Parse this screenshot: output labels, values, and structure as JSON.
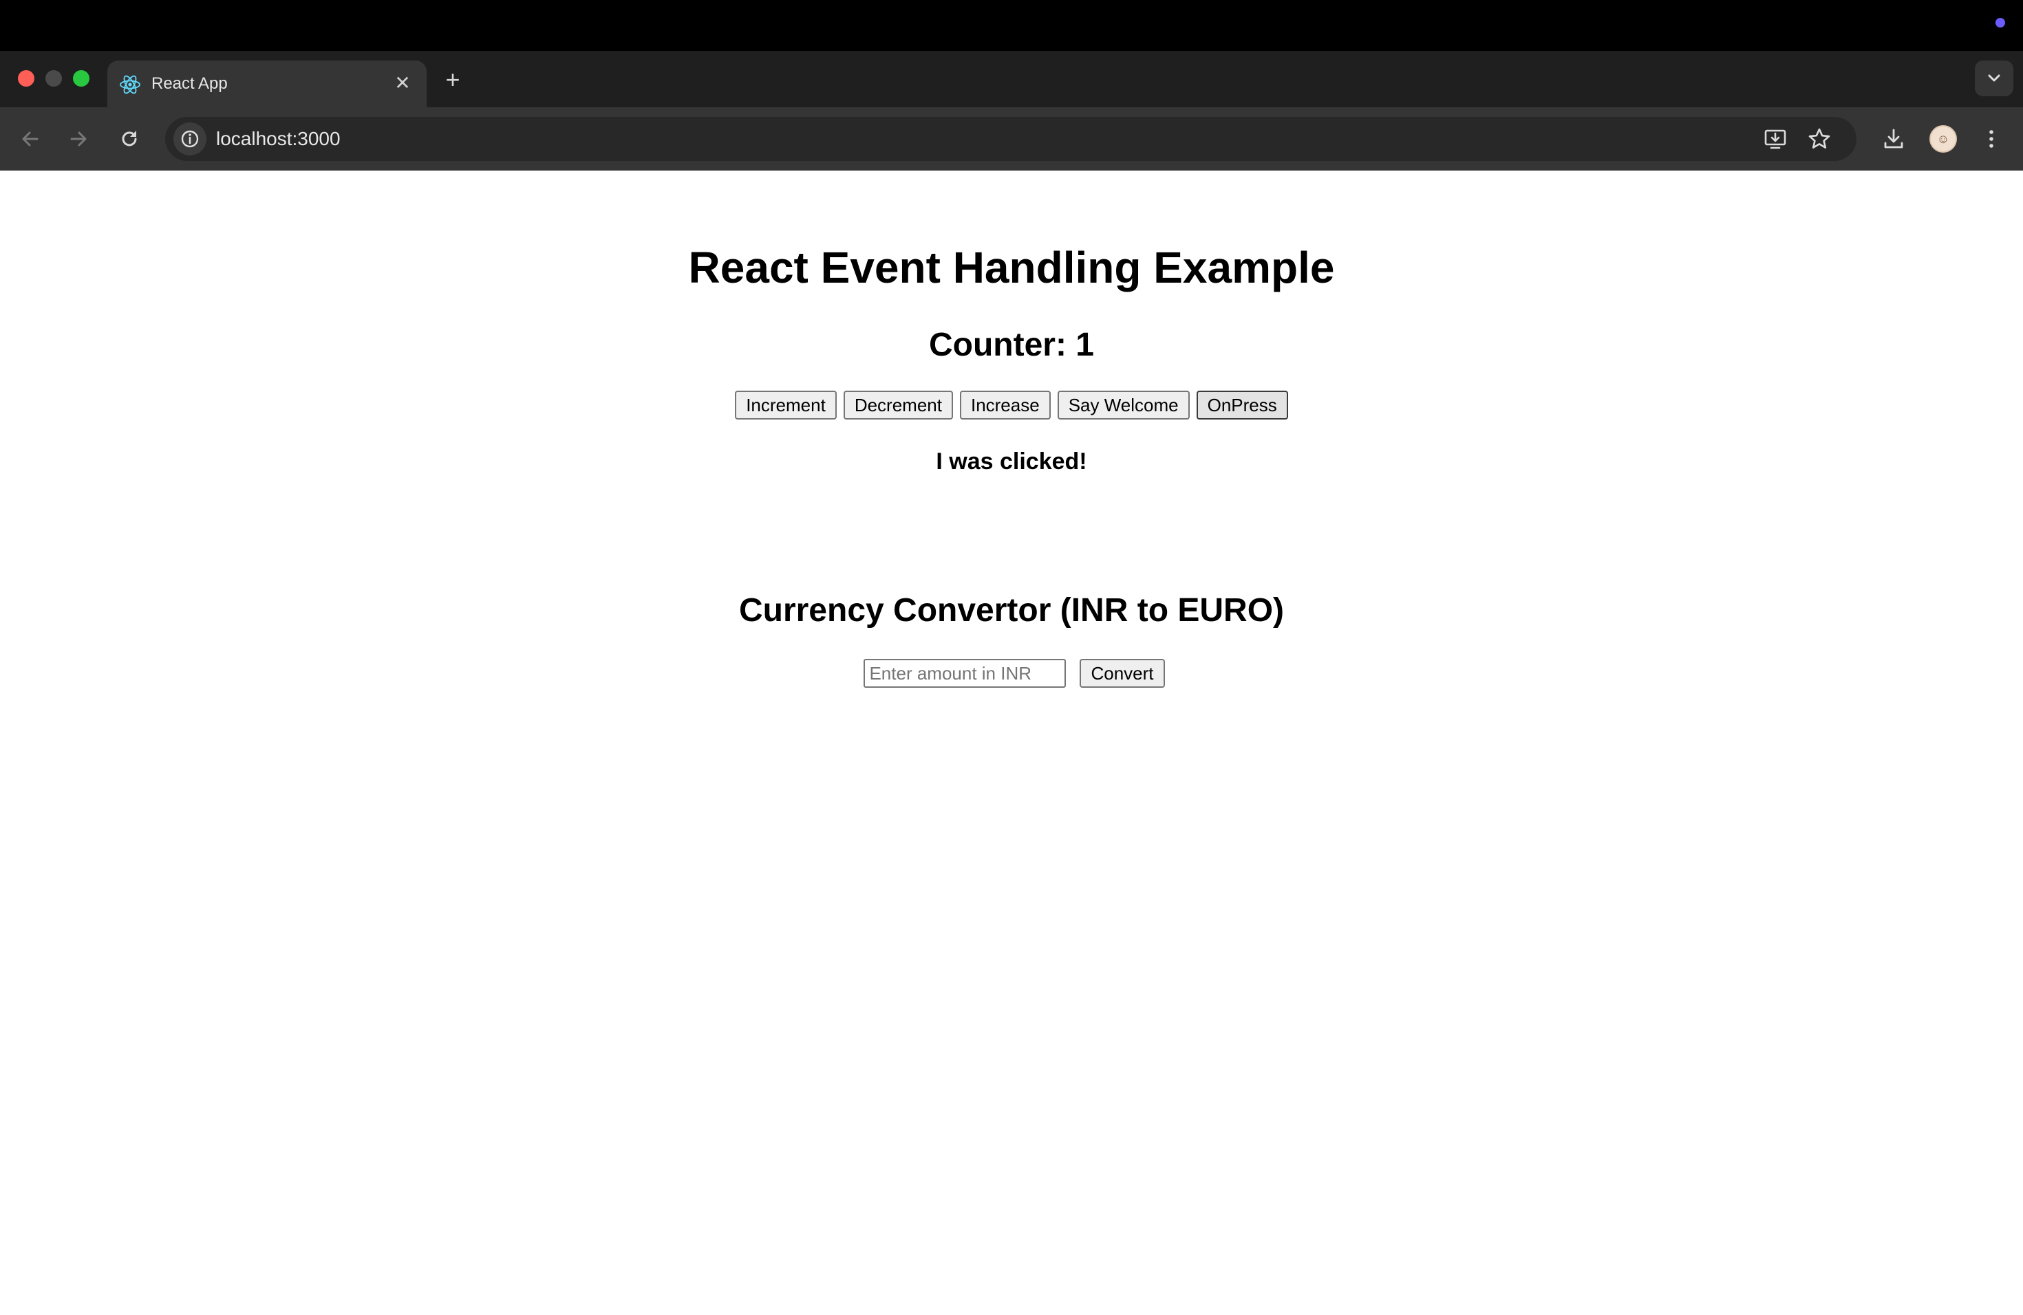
{
  "browser": {
    "tab_title": "React App",
    "url": "localhost:3000"
  },
  "page": {
    "title": "React Event Handling Example",
    "counter_label": "Counter: 1",
    "buttons": {
      "increment": "Increment",
      "decrement": "Decrement",
      "increase": "Increase",
      "say_welcome": "Say Welcome",
      "onpress": "OnPress"
    },
    "message": "I was clicked!",
    "converter": {
      "title": "Currency Convertor (INR to EURO)",
      "placeholder": "Enter amount in INR",
      "convert_label": "Convert"
    }
  },
  "colors": {
    "os_bar": "#000000",
    "tab_strip": "#1f1f1f",
    "toolbar": "#353535",
    "react_logo": "#61dafb"
  }
}
